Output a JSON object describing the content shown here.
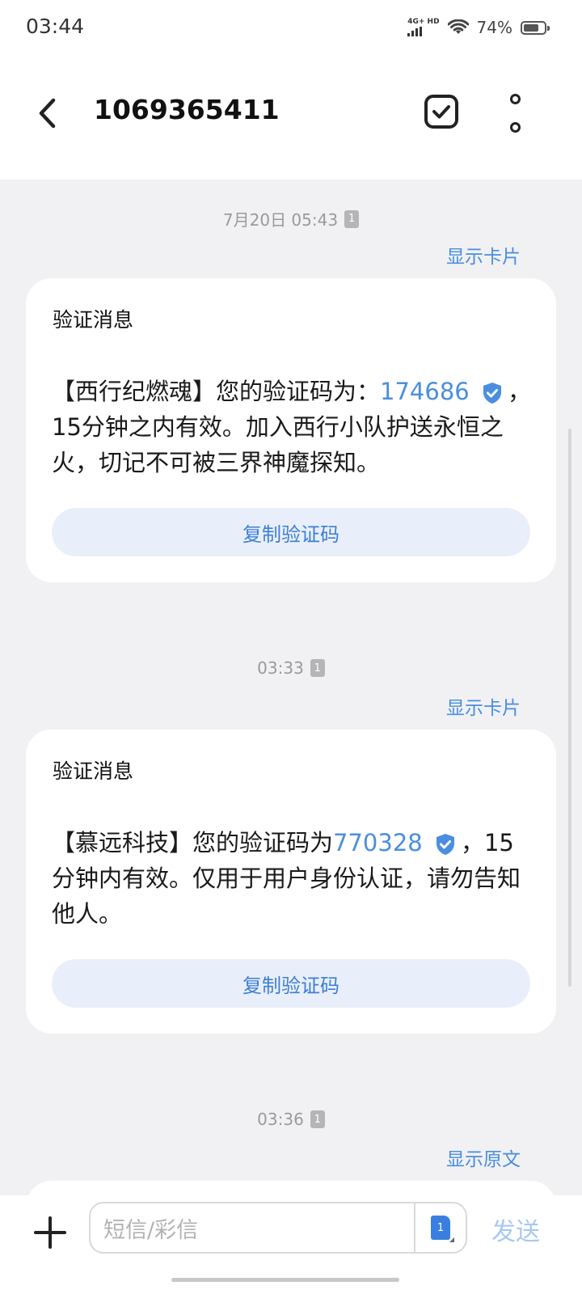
{
  "status_bar": {
    "time": "03:44",
    "network_label": "4G+ HD",
    "battery_percent": "74%",
    "battery_level": 0.74
  },
  "header": {
    "title": "1069365411"
  },
  "messages": [
    {
      "timestamp": "7月20日 05:43",
      "sim": "1",
      "toggle_label": "显示卡片",
      "card_title": "验证消息",
      "text_before": "【西行纪燃魂】您的验证码为：",
      "code": "174686",
      "text_after": "，15分钟之内有效。加入西行小队护送永恒之火，切记不可被三界神魔探知。",
      "copy_label": "复制验证码"
    },
    {
      "timestamp": "03:33",
      "sim": "1",
      "toggle_label": "显示卡片",
      "card_title": "验证消息",
      "text_before": "【慕远科技】您的验证码为",
      "code": "770328",
      "text_after": "，15分钟内有效。仅用于用户身份认证，请勿告知他人。",
      "copy_label": "复制验证码"
    },
    {
      "timestamp": "03:36",
      "sim": "1",
      "toggle_label": "显示原文"
    }
  ],
  "composer": {
    "placeholder": "短信/彩信",
    "sim": "1",
    "send_label": "发送"
  },
  "colors": {
    "accent": "#4a8ee0",
    "copy_button_bg": "#e9effa",
    "background": "#f1f1f3"
  }
}
